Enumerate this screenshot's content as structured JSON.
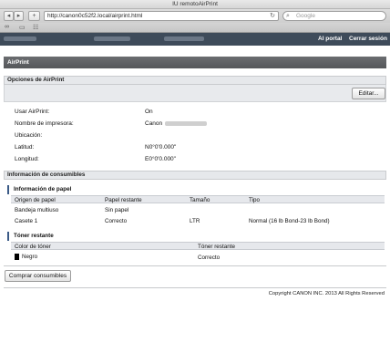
{
  "window": {
    "title": "IU remotoAirPrint"
  },
  "browser": {
    "url": "http://canon0c52f2.local/airprint.html",
    "search_placeholder": "Google"
  },
  "header": {
    "link_portal": "Al portal",
    "link_logout": "Cerrar sesión"
  },
  "page": {
    "section_title": "AirPrint"
  },
  "airprint_options": {
    "heading": "Opciones de AirPrint",
    "edit_label": "Editar...",
    "fields": [
      {
        "label": "Usar AirPrint:",
        "value": "On"
      },
      {
        "label": "Nombre de impresora:",
        "value": "Canon"
      },
      {
        "label": "Ubicación:",
        "value": ""
      },
      {
        "label": "Latitud:",
        "value": "N0°0'0.000\""
      },
      {
        "label": "Longitud:",
        "value": "E0°0'0.000\""
      }
    ]
  },
  "supplies": {
    "heading": "Información de consumibles",
    "paper": {
      "heading": "Información de papel",
      "columns": [
        "Origen de papel",
        "Papel restante",
        "Tamaño",
        "Tipo"
      ],
      "rows": [
        [
          "Bandeja multiuso",
          "Sin papel",
          "",
          ""
        ],
        [
          "Casete 1",
          "Correcto",
          "LTR",
          "Normal (16 lb Bond-23 lb Bond)"
        ]
      ]
    },
    "toner": {
      "heading": "Tóner restante",
      "columns": [
        "Color de tóner",
        "Tóner restante"
      ],
      "rows": [
        [
          "Negro",
          "Correcto"
        ]
      ],
      "swatch_color": "#000000"
    }
  },
  "buy_button_label": "Comprar consumibles",
  "footer": {
    "copyright": "Copyright CANON INC. 2013 All Rights Reserved"
  },
  "colors": {
    "header_bar": "#3e4b5a",
    "section_bar": "#5f6164",
    "subhead_accent": "#3a5a86"
  }
}
